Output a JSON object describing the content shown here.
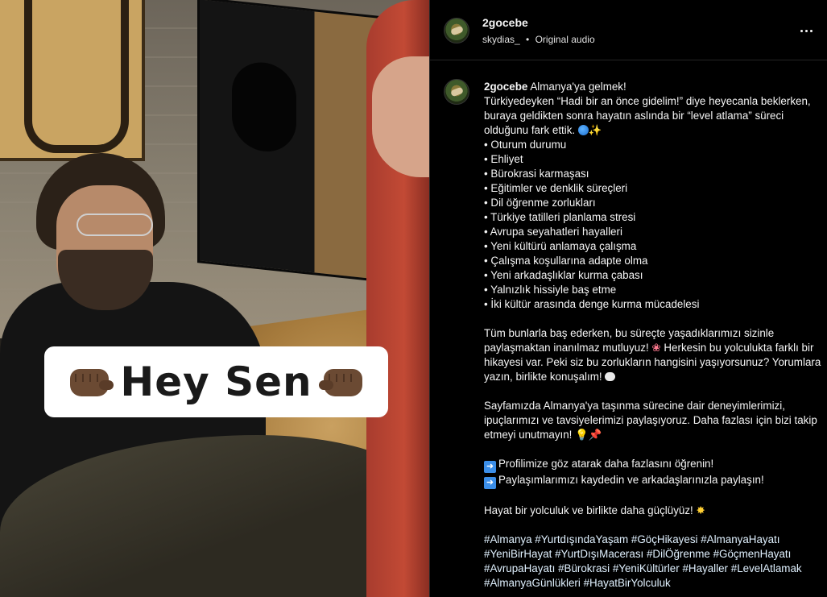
{
  "post": {
    "username": "2gocebe",
    "audio_owner": "skydias_",
    "audio_separator": "•",
    "audio_label": "Original audio"
  },
  "video": {
    "overlay_text": "Hey Sen"
  },
  "caption": {
    "username": "2gocebe",
    "intro_title": "Almanya'ya gelmek!",
    "intro_text": "Türkiyedeyken “Hadi bir an önce gidelim!” diye heyecanla beklerken, buraya geldikten sonra hayatın aslında bir “level atlama” süreci olduğunu fark ettik.",
    "bullets": [
      "• Oturum durumu",
      "• Ehliyet",
      "• Bürokrasi karmaşası",
      "• Eğitimler ve denklik süreçleri",
      "• Dil öğrenme zorlukları",
      "• Türkiye tatilleri planlama stresi",
      "• Avrupa seyahatleri hayalleri",
      "• Yeni kültürü anlamaya çalışma",
      "• Çalışma koşullarına adapte olma",
      "• Yeni arkadaşlıklar kurma çabası",
      "• Yalnızlık hissiyle baş etme",
      "• İki kültür arasında denge kurma mücadelesi"
    ],
    "para1_a": "Tüm bunlarla baş ederken, bu süreçte yaşadıklarımızı sizinle paylaşmaktan inanılmaz mutluyuz!",
    "para1_b": "Herkesin bu yolculukta farklı bir hikayesi var. Peki siz bu zorlukların hangisini yaşıyorsunuz? Yorumlara yazın, birlikte konuşalım!",
    "para2": "Sayfamızda Almanya'ya taşınma sürecine dair deneyimlerimizi, ipuçlarımızı ve tavsiyelerimizi paylaşıyoruz. Daha fazlası için bizi takip etmeyi unutmayın!",
    "cta1": "Profilimize göz atarak daha fazlasını öğrenin!",
    "cta2": "Paylaşımlarımızı kaydedin ve arkadaşlarınızla paylaşın!",
    "closing": "Hayat bir yolculuk ve birlikte daha güçlüyüz!",
    "hashtags": [
      "#Almanya",
      "#YurtdışındaYaşam",
      "#GöçHikayesi",
      "#AlmanyaHayatı",
      "#YeniBirHayat",
      "#YurtDışıMacerası",
      "#DilÖğrenme",
      "#GöçmenHayatı",
      "#AvrupaHayatı",
      "#Bürokrasi",
      "#YeniKültürler",
      "#Hayaller",
      "#LevelAtlamak",
      "#AlmanyaGünlükleri",
      "#HayatBirYolculuk"
    ]
  },
  "icons": {
    "more": "more-horizontal-icon",
    "avatar": "profile-avatar",
    "fist": "fist-bump-icon"
  },
  "colors": {
    "background": "#000000",
    "text": "#f5f5f5",
    "divider": "#262626",
    "overlay_box": "#ffffff",
    "overlay_text": "#1a1a1a"
  }
}
